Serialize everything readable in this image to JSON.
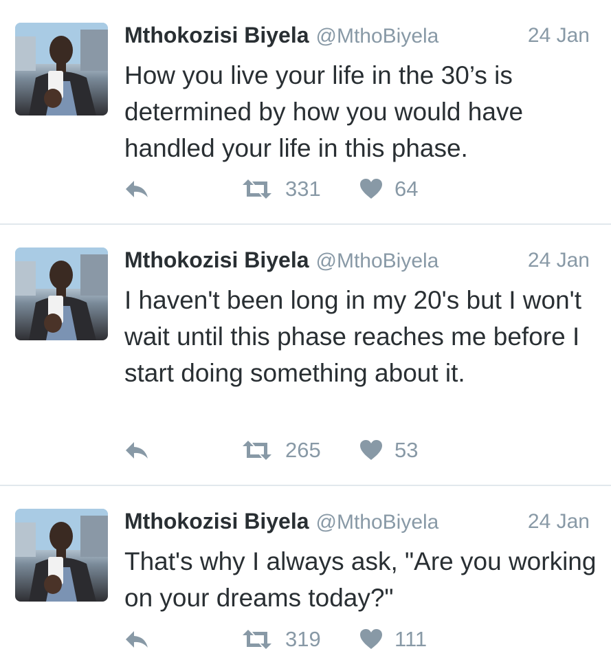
{
  "tweets": [
    {
      "name": "Mthokozisi Biyela",
      "handle": "@MthoBiyela",
      "date": "24 Jan",
      "text": "How you live your life in the 30’s is determined by how you would have handled your life in this phase.",
      "retweets": "331",
      "likes": "64",
      "icons": {
        "reply": "reply-icon",
        "retweet": "retweet-icon",
        "like": "heart-icon"
      }
    },
    {
      "name": "Mthokozisi Biyela",
      "handle": "@MthoBiyela",
      "date": "24 Jan",
      "text": "I haven't been long in my 20's but I won't wait until this phase reaches me before I start doing something about it.",
      "retweets": "265",
      "likes": "53",
      "icons": {
        "reply": "reply-icon",
        "retweet": "retweet-icon",
        "like": "heart-icon"
      }
    },
    {
      "name": "Mthokozisi Biyela",
      "handle": "@MthoBiyela",
      "date": "24 Jan",
      "text": "That's why I always ask, \"Are you working on your dreams today?\"",
      "retweets": "319",
      "likes": "111",
      "icons": {
        "reply": "reply-icon",
        "retweet": "retweet-icon",
        "like": "heart-icon"
      }
    }
  ],
  "colors": {
    "text": "#292f33",
    "muted": "#8899a6",
    "divider": "#e1e8ed",
    "background": "#ffffff"
  }
}
